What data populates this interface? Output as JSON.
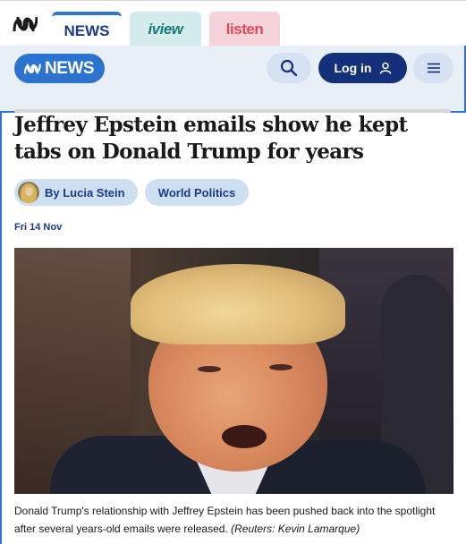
{
  "network_tabs": [
    {
      "label": "NEWS"
    },
    {
      "label": "iview"
    },
    {
      "label": "listen"
    }
  ],
  "header": {
    "logo_text": "NEWS",
    "login_label": "Log in"
  },
  "article": {
    "headline": "Jeffrey Epstein emails show he kept tabs on Donald Trump for years",
    "author": "By Lucia Stein",
    "topic": "World Politics",
    "date": "Fri 14 Nov",
    "caption": "Donald Trump's relationship with Jeffrey Epstein has been pushed back into the spotlight after several years-old emails were released.",
    "credit": "(Reuters: Kevin Lamarque)"
  },
  "colors": {
    "accent": "#2f74d0",
    "login_bg": "#14307a",
    "header_bg": "#e9eff7",
    "pill_bg": "#cfdff2"
  },
  "icons": [
    "abc-logo-icon",
    "search-icon",
    "user-icon",
    "menu-icon"
  ]
}
